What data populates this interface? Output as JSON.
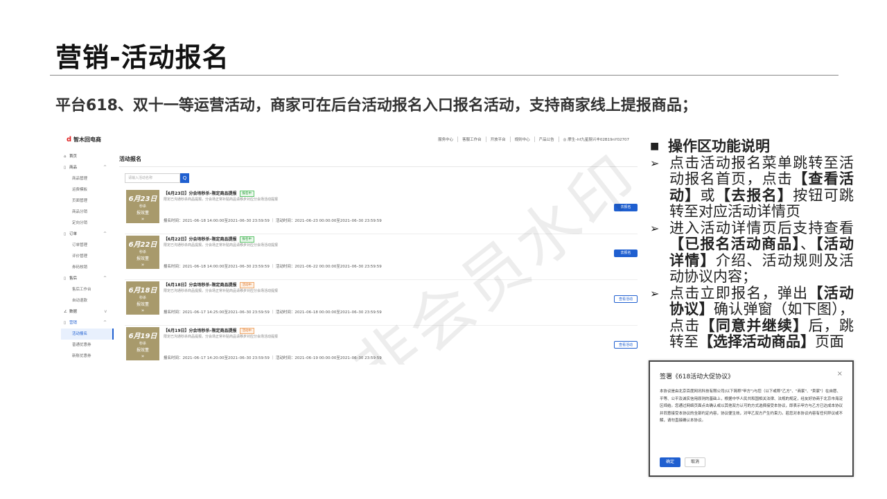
{
  "slide": {
    "title": "营销-活动报名",
    "subtitle": "平台618、双十一等运营活动，商家可在后台活动报名入口报名活动，支持商家线上提报商品；"
  },
  "app": {
    "logo": "智木回电商",
    "nav": [
      "服务中心",
      "客服工作台",
      "开放平台",
      "规则中心",
      "产品公告",
      "◎ 摩生–hf九星厨兴丰02B19nY02707"
    ],
    "sidebar": [
      {
        "label": "首页",
        "group": true,
        "icon": "⌂"
      },
      {
        "label": "商品",
        "group": true,
        "icon": "▯",
        "chev": "^"
      },
      {
        "label": "商品管理"
      },
      {
        "label": "运费模板"
      },
      {
        "label": "页面管理"
      },
      {
        "label": "商品分销"
      },
      {
        "label": "定向分销"
      },
      {
        "label": "订单",
        "group": true,
        "icon": "▯",
        "chev": "^"
      },
      {
        "label": "订单管理"
      },
      {
        "label": "评价管理"
      },
      {
        "label": "券码核销"
      },
      {
        "label": "售后",
        "group": true,
        "icon": "▯",
        "chev": "^"
      },
      {
        "label": "售后工作台"
      },
      {
        "label": "自动退款"
      },
      {
        "label": "数据",
        "group": true,
        "icon": "∠",
        "chev": "v"
      },
      {
        "label": "营销",
        "group": true,
        "icon": "▯",
        "chev": "^",
        "current": true
      },
      {
        "label": "活动报名",
        "active": true
      },
      {
        "label": "普通优惠券"
      },
      {
        "label": "新账优惠券"
      }
    ],
    "page_title": "活动报名",
    "search_placeholder": "请输入活动名称",
    "search_icon": "Q",
    "thumb_line1": "秒杀",
    "thumb_line2": "报效董",
    "thumb_line3": "»",
    "cards": [
      {
        "date": "6月23日",
        "name": "【6月23日】分会场秒杀–限定商品提报",
        "badge": "报名中",
        "badge_color": "green",
        "desc": "限定已沟通秒杀商品提报。分会场正常补贴商品请移步对应分会场活动提报",
        "time": "报名时间：2021–06–18 14:00:00至2021–06–30 23:59:59   ｜   活动时间：2021–06–23 00:00:00至2021–06–30 23:59:59",
        "button": "去报名",
        "button_style": "primary"
      },
      {
        "date": "6月22日",
        "name": "【6月22日】分会场秒杀–限定商品提报",
        "badge": "报名中",
        "badge_color": "green",
        "desc": "限定已沟通秒杀商品提报。分会场正常补贴商品请移步对应分会场活动提报",
        "time": "报名时间：2021–06–18 14:00:00至2021–06–30 23:59:59   ｜   活动时间：2021–06–22 00:00:00至2021–06–30 23:59:59",
        "button": "去报名",
        "button_style": "primary"
      },
      {
        "date": "6月18日",
        "name": "【6月18日】分会场秒杀–限定商品提报",
        "badge": "活动中",
        "badge_color": "orange",
        "desc": "限定已沟通秒杀商品提报。分会场正常补贴商品请移步对应分会场活动提报",
        "time": "报名时间：2021–06–17 14:25:00至2021–06–30 23:59:59   ｜   活动时间：2021–06–18 00:00:00至2021–06–30 23:59:59",
        "button": "查看活动",
        "button_style": "outline"
      },
      {
        "date": "6月19日",
        "name": "【6月19日】分会场秒杀–限定商品提报",
        "badge": "活动中",
        "badge_color": "orange",
        "desc": "限定已沟通秒杀商品提报。分会场正常补贴商品请移步对应分会场活动提报",
        "time": "报名时间：2021–06–17 14:20:00至2021–06–30 23:59:59   ｜   活动时间：2021–06–19 00:00:00至2021–06–30 23:59:59",
        "button": "查看活动",
        "button_style": "outline"
      }
    ],
    "watermark": "非会员水印"
  },
  "explain": {
    "heading": "操作区功能说明",
    "b1_p1": "点击活动报名菜单跳转至活动报名首页，点击",
    "b1_b1": "【查看活动】",
    "b1_p2": "或",
    "b1_b2": "【去报名】",
    "b1_p3": "按钮可跳转至对应活动详情页",
    "b2_p1": "进入活动详情页后支持查看",
    "b2_b1": "【已报名活动商品】",
    "b2_p2": "、",
    "b2_b2": "【活动详情】",
    "b2_p3": "介绍、活动规则及活动协议内容；",
    "b3_p1": "点击立即报名，弹出",
    "b3_b1": "【活动协议】",
    "b3_p2": "确认弹窗（如下图），点击",
    "b3_b2": "【同意并继续】",
    "b3_p3": "后，跳转至",
    "b3_b3": "【选择活动商品】",
    "b3_p4": "页面"
  },
  "dialog": {
    "title": "签署《618活动大促协议》",
    "close": "×",
    "body": "本协议是由北京百度网讯科技有限公司(以下简称\"甲方\")与您（以下或称\"乙方\"、\"商家\"、\"卖家\"）在自愿、平等、公平及诚实信用原则的基础上，根据中华人民共和国相关法律、法规的规定，经友好协商于北京市海淀区缔结。您通过网络页面点击确认或以其他双方认可的方式选择接受本协议，即表示甲方与乙方已达成本协议并同意接受本协议的全部约定内容，协议便生效，对甲乙双方产生约束力。若您对本协议内容有任何异议或不解，请勿直接确认本协议。",
    "ok": "确定",
    "cancel": "取消"
  }
}
